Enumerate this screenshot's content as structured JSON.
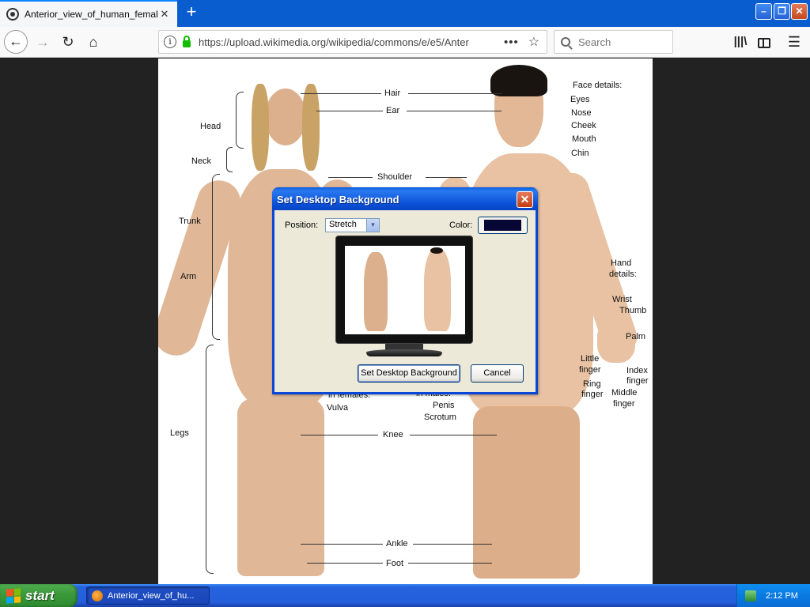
{
  "browser": {
    "tab_title": "Anterior_view_of_human_female_",
    "tab_close": "✕",
    "new_tab": "+",
    "url": "https://upload.wikimedia.org/wikipedia/commons/e/e5/Anter",
    "search_placeholder": "Search",
    "window": {
      "min": "–",
      "max": "❐",
      "close": "✕"
    }
  },
  "image_labels": {
    "hair": "Hair",
    "ear": "Ear",
    "head": "Head",
    "neck": "Neck",
    "shoulder": "Shoulder",
    "trunk": "Trunk",
    "arm": "Arm",
    "legs": "Legs",
    "knee": "Knee",
    "ankle": "Ankle",
    "foot": "Foot",
    "in_females": "in females:",
    "vulva": "Vulva",
    "in_males": "in males:",
    "penis": "Penis",
    "scrotum": "Scrotum",
    "face_details": "Face details:",
    "eyes": "Eyes",
    "nose": "Nose",
    "cheek": "Cheek",
    "mouth": "Mouth",
    "chin": "Chin",
    "hand_details_1": "Hand",
    "hand_details_2": "details:",
    "wrist": "Wrist",
    "thumb": "Thumb",
    "palm": "Palm",
    "little_1": "Little",
    "little_2": "finger",
    "ring_1": "Ring",
    "ring_2": "finger",
    "index_1": "Index",
    "index_2": "finger",
    "middle_1": "Middle",
    "middle_2": "finger"
  },
  "dialog": {
    "title": "Set Desktop Background",
    "close": "✕",
    "position_label": "Position:",
    "position_value": "Stretch",
    "color_label": "Color:",
    "color_value": "#070735",
    "set_button": "Set Desktop Background",
    "cancel_button": "Cancel"
  },
  "taskbar": {
    "start": "start",
    "task_item": "Anterior_view_of_hu...",
    "clock": "2:12 PM"
  }
}
